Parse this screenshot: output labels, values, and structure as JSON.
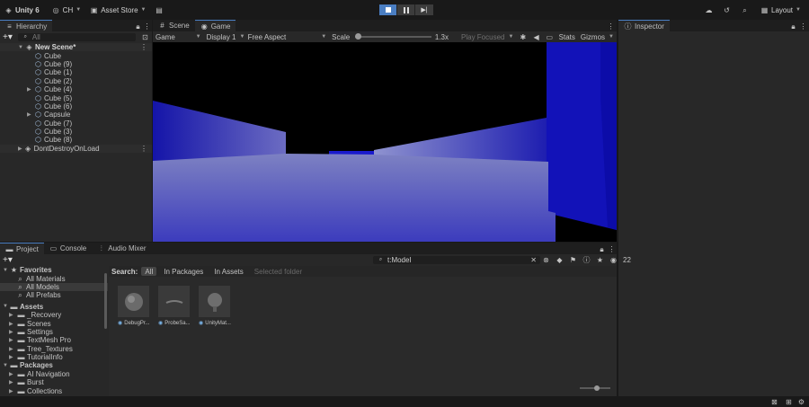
{
  "toolbar": {
    "account": "Unity 6",
    "user": "CH",
    "asset_store": "Asset Store",
    "layout": "Layout"
  },
  "hierarchy": {
    "tab": "Hierarchy",
    "search_placeholder": "All",
    "scene": "New Scene*",
    "items": [
      {
        "label": "Cube",
        "expandable": false
      },
      {
        "label": "Cube (9)",
        "expandable": false
      },
      {
        "label": "Cube (1)",
        "expandable": false
      },
      {
        "label": "Cube (2)",
        "expandable": false
      },
      {
        "label": "Cube (4)",
        "expandable": true
      },
      {
        "label": "Cube (5)",
        "expandable": false
      },
      {
        "label": "Cube (6)",
        "expandable": false
      },
      {
        "label": "Capsule",
        "expandable": true
      },
      {
        "label": "Cube (7)",
        "expandable": false
      },
      {
        "label": "Cube (3)",
        "expandable": false
      },
      {
        "label": "Cube (8)",
        "expandable": false
      }
    ],
    "dont_destroy": "DontDestroyOnLoad"
  },
  "game_view": {
    "tabs": [
      "Scene",
      "Game"
    ],
    "mode": "Game",
    "display": "Display 1",
    "aspect": "Free Aspect",
    "scale_label": "Scale",
    "scale_value": "1.3x",
    "play_focused": "Play Focused",
    "stats": "Stats",
    "gizmos": "Gizmos"
  },
  "inspector": {
    "tab": "Inspector"
  },
  "project": {
    "tabs": [
      "Project",
      "Console",
      "Audio Mixer"
    ],
    "search_value": "t:Model",
    "count": "22",
    "search_label": "Search:",
    "filters": [
      "All",
      "In Packages",
      "In Assets",
      "Selected folder"
    ],
    "favorites_label": "Favorites",
    "favorites": [
      "All Materials",
      "All Models",
      "All Prefabs"
    ],
    "assets_label": "Assets",
    "assets": [
      "_Recovery",
      "Scenes",
      "Settings",
      "TextMesh Pro",
      "Tree_Textures",
      "TutorialInfo"
    ],
    "packages_label": "Packages",
    "packages": [
      "AI Navigation",
      "Burst",
      "Collections"
    ],
    "models": [
      "DebugPr...",
      "ProbeSa...",
      "UnityMat..."
    ]
  },
  "colors": {
    "accent": "#4a7ec2",
    "panel": "#282828",
    "background": "#191919"
  }
}
